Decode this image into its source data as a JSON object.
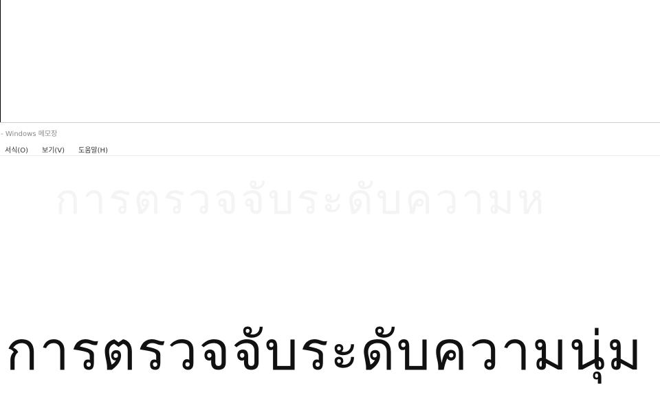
{
  "window": {
    "title": "t - Windows 메모장"
  },
  "menu": {
    "items": [
      {
        "label": "서식(O)"
      },
      {
        "label": "보기(V)"
      },
      {
        "label": "도움말(H)"
      }
    ]
  },
  "editor": {
    "watermark_text": "การตรวจจับระดับความห",
    "content": "การตรวจจับระดับความนุ่ม"
  }
}
